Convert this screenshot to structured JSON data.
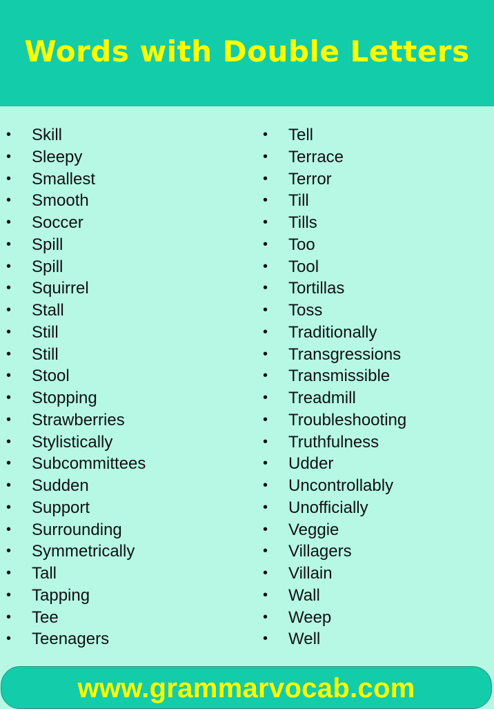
{
  "header": {
    "title": "Words with Double Letters"
  },
  "colors": {
    "header_bg": "#13cca9",
    "body_bg": "#b6f8e4",
    "title_text": "#fbff00",
    "list_text": "#111111"
  },
  "bullet_glyph": "•",
  "lists": {
    "left": [
      "Skill",
      "Sleepy",
      "Smallest",
      "Smooth",
      "Soccer",
      "Spill",
      "Spill",
      "Squirrel",
      "Stall",
      "Still",
      "Still",
      "Stool",
      "Stopping",
      "Strawberries",
      "Stylistically",
      "Subcommittees",
      "Sudden",
      "Support",
      "Surrounding",
      "Symmetrically",
      "Tall",
      "Tapping",
      "Tee",
      "Teenagers"
    ],
    "right": [
      "Tell",
      "Terrace",
      "Terror",
      "Till",
      "Tills",
      "Too",
      "Tool",
      "Tortillas",
      "Toss",
      "Traditionally",
      "Transgressions",
      "Transmissible",
      "Treadmill",
      "Troubleshooting",
      "Truthfulness",
      "Udder",
      "Uncontrollably",
      "Unofficially",
      "Veggie",
      "Villagers",
      "Villain",
      "Wall",
      "Weep",
      "Well"
    ]
  },
  "footer": {
    "url": "www.grammarvocab.com"
  }
}
